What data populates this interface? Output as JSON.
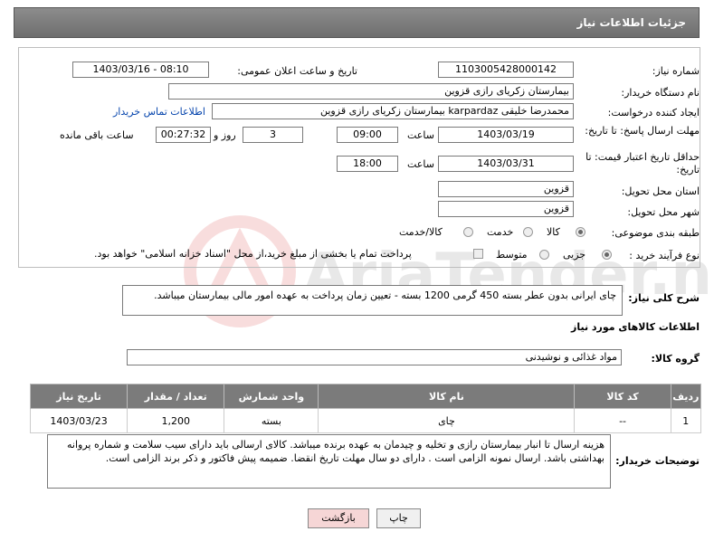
{
  "page": {
    "title": "جزئیات اطلاعات نیاز"
  },
  "form": {
    "need_number_label": "شماره نیاز:",
    "need_number": "1103005428000142",
    "announce_label": "تاریخ و ساعت اعلان عمومی:",
    "announce_value": "1403/03/16 - 08:10",
    "buyer_org_label": "نام دستگاه خریدار:",
    "buyer_org": "بیمارستان زکریای رازی قزوین",
    "creator_label": "ایجاد کننده درخواست:",
    "creator": "محمدرضا خلیقی karpardaz بیمارستان زکریای رازی قزوین",
    "contact_link": "اطلاعات تماس خریدار",
    "deadline_label": "مهلت ارسال پاسخ: تا تاریخ:",
    "deadline_date": "1403/03/19",
    "time_word": "ساعت",
    "deadline_time": "09:00",
    "days_value": "3",
    "days_word": "روز و",
    "remaining_time": "00:27:32",
    "remaining_word": "ساعت باقی مانده",
    "validity_label": "حداقل تاریخ اعتبار قیمت: تا تاریخ:",
    "validity_date": "1403/03/31",
    "validity_time": "18:00",
    "province_label": "استان محل تحویل:",
    "province": "قزوین",
    "city_label": "شهر محل تحویل:",
    "city": "قزوین",
    "category_label": "طبقه بندی موضوعی:",
    "category_options": [
      "کالا",
      "خدمت",
      "کالا/خدمت"
    ],
    "category_selected": "کالا",
    "process_label": "نوع فرآیند خرید :",
    "process_options": [
      "جزیی",
      "متوسط"
    ],
    "process_selected": "جزیی",
    "payment_note": "پرداخت تمام یا بخشی از مبلغ خرید،از محل \"اسناد خزانه اسلامی\" خواهد بود."
  },
  "description": {
    "label": "شرح کلی نیاز:",
    "text": "چای ایرانی بدون عطر بسته 450 گرمی 1200 بسته - تعیین زمان پرداخت به عهده امور مالی بیمارستان میباشد."
  },
  "items_section": {
    "title": "اطلاعات کالاهای مورد نیاز",
    "group_label": "گروه کالا:",
    "group_value": "مواد غذائی و نوشیدنی",
    "columns": [
      "ردیف",
      "کد کالا",
      "نام کالا",
      "واحد شمارش",
      "تعداد / مقدار",
      "تاریخ نیاز"
    ],
    "rows": [
      {
        "row": "1",
        "code": "--",
        "name": "چای",
        "unit": "بسته",
        "qty": "1,200",
        "date": "1403/03/23"
      }
    ]
  },
  "buyer_notes": {
    "label": "توضیحات خریدار:",
    "text": "هزینه ارسال تا انبار بیمارستان رازی و تخلیه و چیدمان به عهده برنده میباشد. کالای ارسالی باید دارای سیب سلامت و شماره پروانه بهداشتی باشد. ارسال نمونه الزامی است . دارای دو سال مهلت تاریخ انقضا. ضمیمه پیش فاکتور و ذکر برند الزامی است."
  },
  "buttons": {
    "print": "چاپ",
    "back": "بازگشت"
  },
  "watermark": {
    "text": "AriaTender.net"
  },
  "colors": {
    "title_bar": "#7b7b7b",
    "back_button_bg": "#f6d6d6",
    "link": "#0645ad"
  }
}
